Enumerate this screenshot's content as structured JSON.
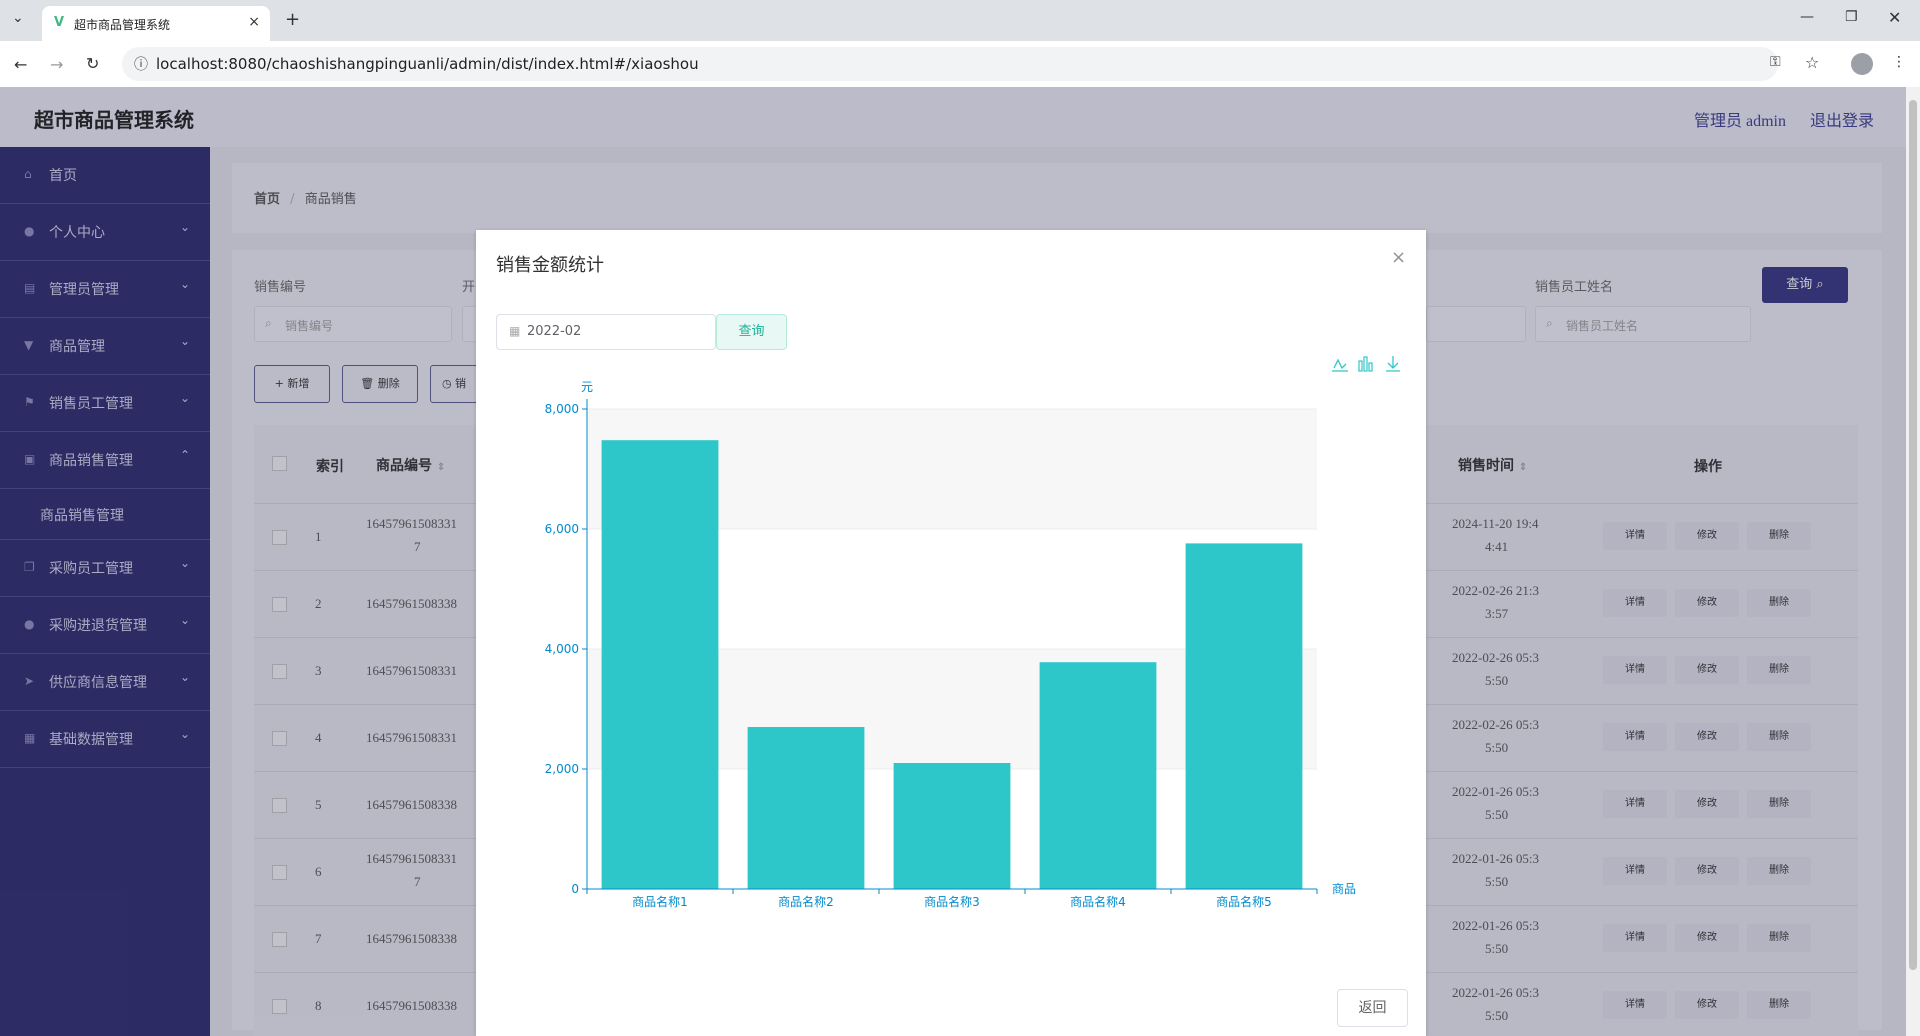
{
  "browser": {
    "tab_title": "超市商品管理系统",
    "url": "localhost:8080/chaoshishangpinguanli/admin/dist/index.html#/xiaoshou"
  },
  "app": {
    "title": "超市商品管理系统",
    "user": "管理员 admin",
    "logout": "退出登录"
  },
  "sidebar": {
    "items": [
      {
        "label": "首页",
        "icon": "home-icon"
      },
      {
        "label": "个人中心",
        "icon": "user-icon"
      },
      {
        "label": "管理员管理",
        "icon": "clipboard-icon"
      },
      {
        "label": "商品管理",
        "icon": "cup-icon"
      },
      {
        "label": "销售员工管理",
        "icon": "flag-icon"
      },
      {
        "label": "商品销售管理",
        "icon": "box-icon"
      },
      {
        "label": "商品销售管理",
        "icon": ""
      },
      {
        "label": "采购员工管理",
        "icon": "copy-icon"
      },
      {
        "label": "采购进退货管理",
        "icon": "mic-icon"
      },
      {
        "label": "供应商信息管理",
        "icon": "send-icon"
      },
      {
        "label": "基础数据管理",
        "icon": "grid-icon"
      }
    ]
  },
  "breadcrumb": {
    "home": "首页",
    "sep": "/",
    "current": "商品销售"
  },
  "search": {
    "label1": "销售编号",
    "placeholder1": "销售编号",
    "label2": "开",
    "label3": "销售员工姓名",
    "placeholder3": "销售员工姓名",
    "query": "查询"
  },
  "toolbar": {
    "add": "+ 新增",
    "delete": "删除",
    "stat": "销"
  },
  "table": {
    "headers": {
      "index": "索引",
      "code": "商品编号",
      "time": "销售时间",
      "ops": "操作"
    },
    "rows": [
      {
        "i": "1",
        "code": "16457961508331",
        "code2": "7",
        "t1": "2024-11-20 19:4",
        "t2": "4:41"
      },
      {
        "i": "2",
        "code": "16457961508338",
        "code2": "",
        "t1": "2022-02-26 21:3",
        "t2": "3:57"
      },
      {
        "i": "3",
        "code": "16457961508331",
        "code2": "",
        "t1": "2022-02-26 05:3",
        "t2": "5:50"
      },
      {
        "i": "4",
        "code": "16457961508331",
        "code2": "",
        "t1": "2022-02-26 05:3",
        "t2": "5:50"
      },
      {
        "i": "5",
        "code": "16457961508338",
        "code2": "",
        "t1": "2022-01-26 05:3",
        "t2": "5:50"
      },
      {
        "i": "6",
        "code": "16457961508331",
        "code2": "7",
        "t1": "2022-01-26 05:3",
        "t2": "5:50"
      },
      {
        "i": "7",
        "code": "16457961508338",
        "code2": "",
        "t1": "2022-01-26 05:3",
        "t2": "5:50"
      },
      {
        "i": "8",
        "code": "16457961508338",
        "code2": "",
        "t1": "2022-01-26 05:3",
        "t2": "5:50"
      }
    ],
    "op_detail": "详情",
    "op_edit": "修改",
    "op_delete": "删除"
  },
  "dialog": {
    "title": "销售金额统计",
    "month_value": "2022-02",
    "query": "查询",
    "return": "返回"
  },
  "chart_data": {
    "type": "bar",
    "title": "",
    "xlabel": "商品",
    "ylabel": "元",
    "categories": [
      "商品名称1",
      "商品名称2",
      "商品名称3",
      "商品名称4",
      "商品名称5"
    ],
    "values": [
      7480,
      2700,
      2100,
      3780,
      5760
    ],
    "ylim": [
      0,
      8000
    ],
    "yticks": [
      "0",
      "2,000",
      "4,000",
      "6,000",
      "8,000"
    ],
    "bar_color": "#2ec7c9",
    "axis_color": "#008acd"
  }
}
